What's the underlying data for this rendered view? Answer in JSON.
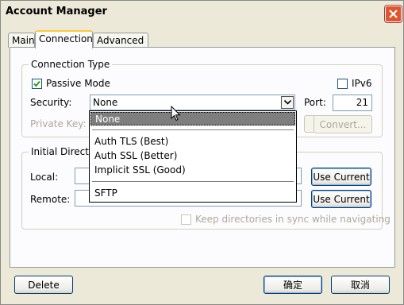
{
  "window": {
    "title": "Account Manager"
  },
  "tabs": [
    {
      "label": "Main"
    },
    {
      "label": "Connection"
    },
    {
      "label": "Advanced"
    }
  ],
  "connection_type": {
    "legend": "Connection Type",
    "passive_mode": {
      "label": "Passive Mode",
      "checked": true
    },
    "ipv6": {
      "label": "IPv6",
      "checked": false
    },
    "security": {
      "label": "Security:",
      "value": "None"
    },
    "port": {
      "label": "Port:",
      "value": "21"
    },
    "private_key": {
      "label": "Private Key:",
      "value": ""
    },
    "convert_button": "Convert..."
  },
  "security_dropdown": {
    "options": [
      "None",
      "Auth TLS (Best)",
      "Auth SSL (Better)",
      "Implicit SSL (Good)",
      "SFTP"
    ],
    "selected": "None"
  },
  "initial_directories": {
    "legend": "Initial Directories",
    "local": {
      "label": "Local:",
      "value": "",
      "button": "Use Current"
    },
    "remote": {
      "label": "Remote:",
      "value": "",
      "button": "Use Current"
    },
    "sync": {
      "label": "Keep directories in sync while navigating",
      "checked": false
    }
  },
  "footer": {
    "delete_button": "Delete",
    "ok_button": "确定",
    "cancel_button": "取消"
  },
  "icons": {
    "close": "close-icon",
    "check": "check-icon",
    "dropdown_arrow": "chevron-down-icon",
    "cursor": "mouse-cursor-icon"
  }
}
